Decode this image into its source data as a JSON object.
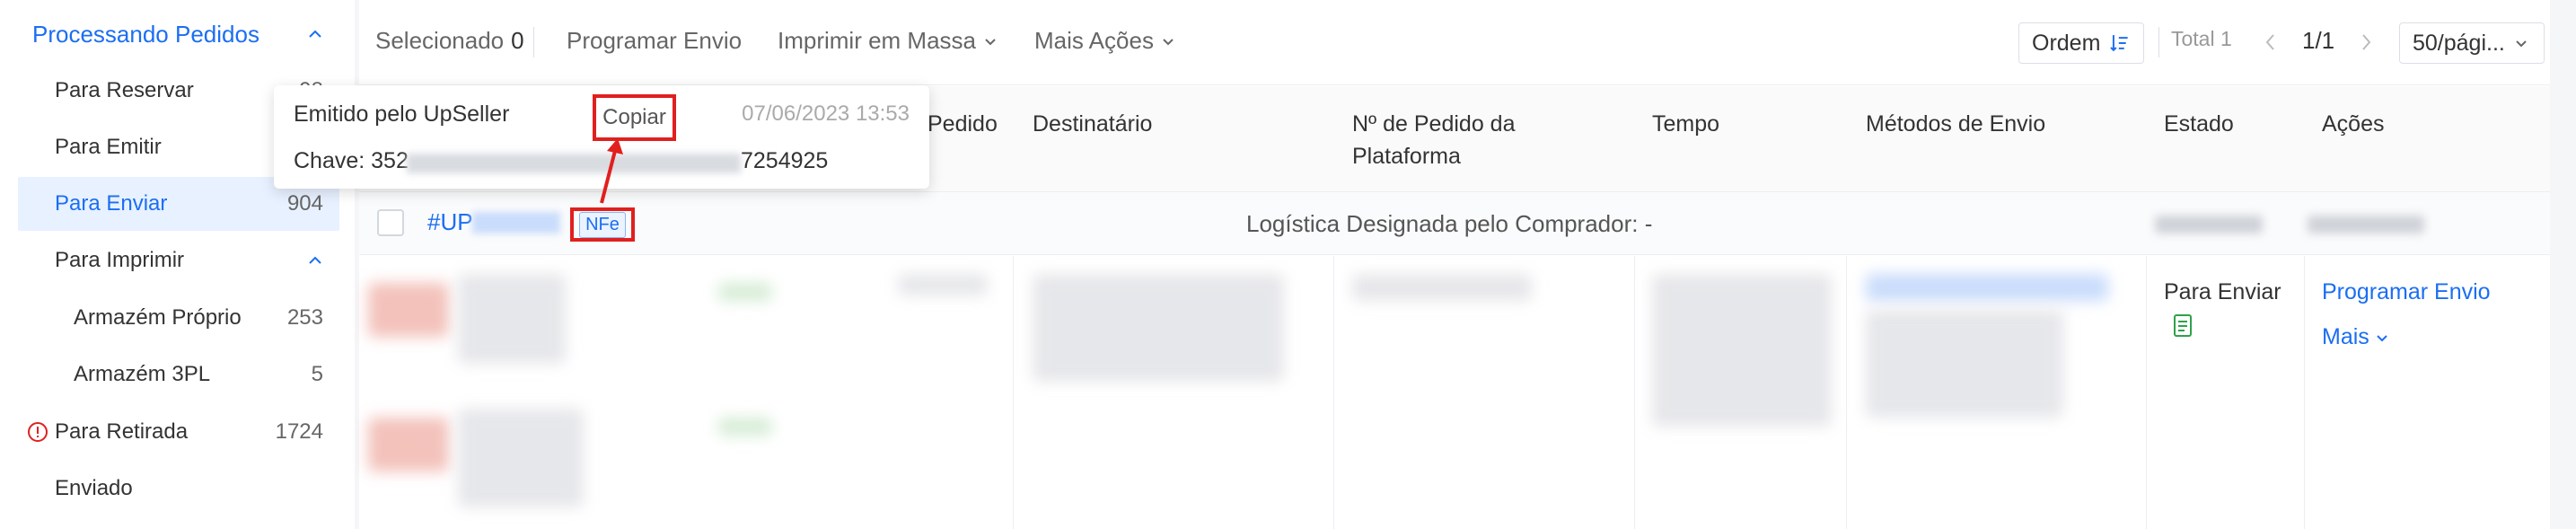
{
  "sidebar": {
    "header": "Processando Pedidos",
    "items": [
      {
        "label": "Para Reservar",
        "count": "98"
      },
      {
        "label": "Para Emitir",
        "count": ""
      },
      {
        "label": "Para Enviar",
        "count": "904"
      },
      {
        "label": "Para Imprimir",
        "count": ""
      },
      {
        "label": "Armazém Próprio",
        "count": "253"
      },
      {
        "label": "Armazém 3PL",
        "count": "5"
      },
      {
        "label": "Para Retirada",
        "count": "1724"
      },
      {
        "label": "Enviado",
        "count": ""
      }
    ]
  },
  "toolbar": {
    "selected_label": "Selecionado",
    "selected_count": "0",
    "schedule": "Programar Envio",
    "bulk_print": "Imprimir em Massa",
    "more_actions": "Mais Ações",
    "order": "Ordem",
    "total": "Total 1",
    "page": "1/1",
    "per_page": "50/pági..."
  },
  "table": {
    "headers": {
      "pedido": "Pedido",
      "destinatario": "Destinatário",
      "platform_order_1": "Nº de Pedido da",
      "platform_order_2": "Plataforma",
      "tempo": "Tempo",
      "metodos": "Métodos de Envio",
      "estado": "Estado",
      "acoes": "Ações"
    },
    "group": {
      "order_prefix": "#UP",
      "nfe_badge": "NFe",
      "logistics": "Logística Designada pelo Comprador: -"
    },
    "row": {
      "estado": "Para Enviar",
      "action_schedule": "Programar Envio",
      "action_more": "Mais"
    }
  },
  "popover": {
    "title": "Emitido pelo UpSeller",
    "copy_button": "Copiar",
    "date": "07/06/2023 13:53",
    "key_prefix": "Chave: 352",
    "key_suffix": "7254925"
  },
  "colors": {
    "accent": "#1b6ef3",
    "highlight": "#e0201e",
    "alert": "#e0201e"
  }
}
